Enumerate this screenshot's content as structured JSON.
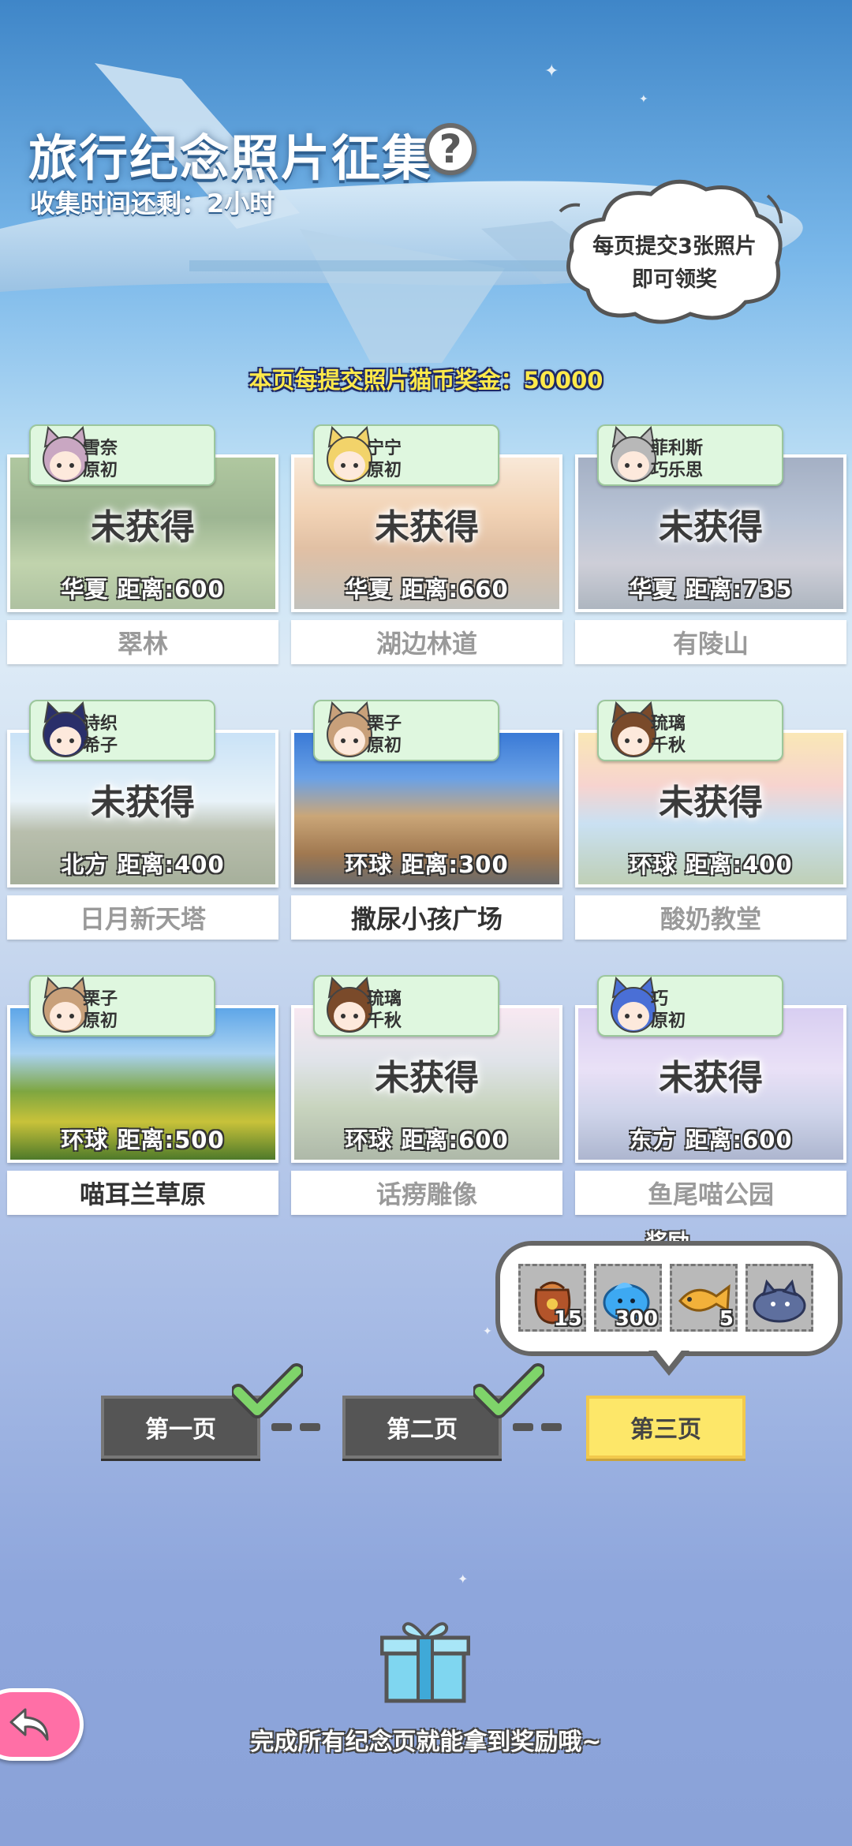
{
  "header": {
    "title": "旅行纪念照片征集",
    "help_icon": "?",
    "timer": "收集时间还剩：2小时",
    "hint_line1": "每页提交3张照片",
    "hint_line2": "即可领奖",
    "bonus": "本页每提交照片猫币奖金：50000"
  },
  "cards": [
    {
      "name": "翠林",
      "region": "华夏",
      "distance": "距离:600",
      "cat1": "雪奈",
      "cat2": "原初",
      "status": "未获得",
      "obtained": false
    },
    {
      "name": "湖边林道",
      "region": "华夏",
      "distance": "距离:660",
      "cat1": "宁宁",
      "cat2": "原初",
      "status": "未获得",
      "obtained": false
    },
    {
      "name": "有陵山",
      "region": "华夏",
      "distance": "距离:735",
      "cat1": "菲利斯",
      "cat2": "巧乐思",
      "status": "未获得",
      "obtained": false
    },
    {
      "name": "日月新天塔",
      "region": "北方",
      "distance": "距离:400",
      "cat1": "诗织",
      "cat2": "希子",
      "status": "未获得",
      "obtained": false
    },
    {
      "name": "撒尿小孩广场",
      "region": "环球",
      "distance": "距离:300",
      "cat1": "栗子",
      "cat2": "原初",
      "status": "",
      "obtained": true
    },
    {
      "name": "酸奶教堂",
      "region": "环球",
      "distance": "距离:400",
      "cat1": "琉璃",
      "cat2": "千秋",
      "status": "未获得",
      "obtained": false
    },
    {
      "name": "喵耳兰草原",
      "region": "环球",
      "distance": "距离:500",
      "cat1": "栗子",
      "cat2": "原初",
      "status": "",
      "obtained": true
    },
    {
      "name": "话痨雕像",
      "region": "环球",
      "distance": "距离:600",
      "cat1": "琉璃",
      "cat2": "千秋",
      "status": "未获得",
      "obtained": false
    },
    {
      "name": "鱼尾喵公园",
      "region": "东方",
      "distance": "距离:600",
      "cat1": "巧",
      "cat2": "原初",
      "status": "未获得",
      "obtained": false
    }
  ],
  "rewards": {
    "label": "奖励",
    "items": [
      {
        "icon": "treasure-bag-icon",
        "qty": "15"
      },
      {
        "icon": "blue-slime-icon",
        "qty": "300"
      },
      {
        "icon": "fish-icon",
        "qty": "5"
      },
      {
        "icon": "cat-cushion-icon",
        "qty": ""
      }
    ]
  },
  "pages": [
    {
      "label": "第一页",
      "completed": true
    },
    {
      "label": "第二页",
      "completed": true
    },
    {
      "label": "第三页",
      "completed": false,
      "active": true
    }
  ],
  "footer": {
    "text": "完成所有纪念页就能拿到奖励哦~"
  },
  "colors": {
    "active_page": "#fde769",
    "tag_bg": "#dff7df",
    "back_button": "#ff6fa6",
    "bonus_text": "#ffe94a"
  }
}
